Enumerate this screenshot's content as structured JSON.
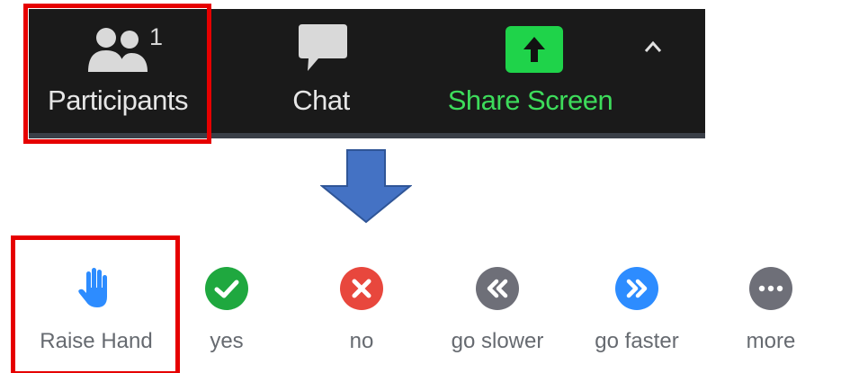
{
  "toolbar": {
    "participants": {
      "label": "Participants",
      "count": "1",
      "icon": "participants-icon"
    },
    "chat": {
      "label": "Chat",
      "icon": "chat-icon"
    },
    "share_screen": {
      "label": "Share Screen",
      "icon": "share-screen-icon",
      "caret_icon": "caret-up-icon"
    }
  },
  "reactions": {
    "raise_hand": {
      "label": "Raise Hand",
      "icon": "raise-hand-icon"
    },
    "yes": {
      "label": "yes",
      "icon": "check-icon"
    },
    "no": {
      "label": "no",
      "icon": "x-icon"
    },
    "go_slower": {
      "label": "go slower",
      "icon": "rewind-icon"
    },
    "go_faster": {
      "label": "go faster",
      "icon": "fast-forward-icon"
    },
    "more": {
      "label": "more",
      "icon": "ellipsis-icon"
    }
  },
  "colors": {
    "toolbar_bg": "#1a1a1a",
    "toolbar_text": "#e6e6e6",
    "share_green": "#3ddc5b",
    "highlight_red": "#e60000",
    "arrow_blue": "#4472c4",
    "yes_green": "#1fa83f",
    "no_red": "#e8473d",
    "slower_gray": "#6e6f78",
    "faster_blue": "#2d8cff",
    "more_gray": "#6e6f78",
    "hand_blue": "#2d8cff",
    "reaction_text": "#666a70"
  }
}
